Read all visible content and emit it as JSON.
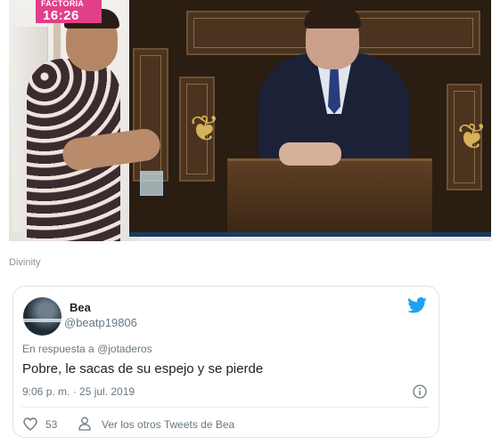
{
  "media": {
    "channel_name": "FACTORIA",
    "channel_time": "16:26",
    "caption": "Divinity"
  },
  "tweet": {
    "author_name": "Bea",
    "author_handle": "@beatp19806",
    "reply_prefix": "En respuesta a",
    "reply_handle": "@jotaderos",
    "text": "Pobre, le sacas de su espejo y se pierde",
    "timestamp": "9:06 p. m. · 25 jul. 2019",
    "like_count": "53",
    "more_tweets_label": "Ver los otros Tweets de Bea"
  },
  "colors": {
    "twitter_blue": "#1da1f2",
    "channel_pink": "#e23f8a",
    "secondary_text": "#697882"
  },
  "icons": [
    "twitter-logo-icon",
    "info-icon",
    "heart-icon",
    "person-icon"
  ]
}
